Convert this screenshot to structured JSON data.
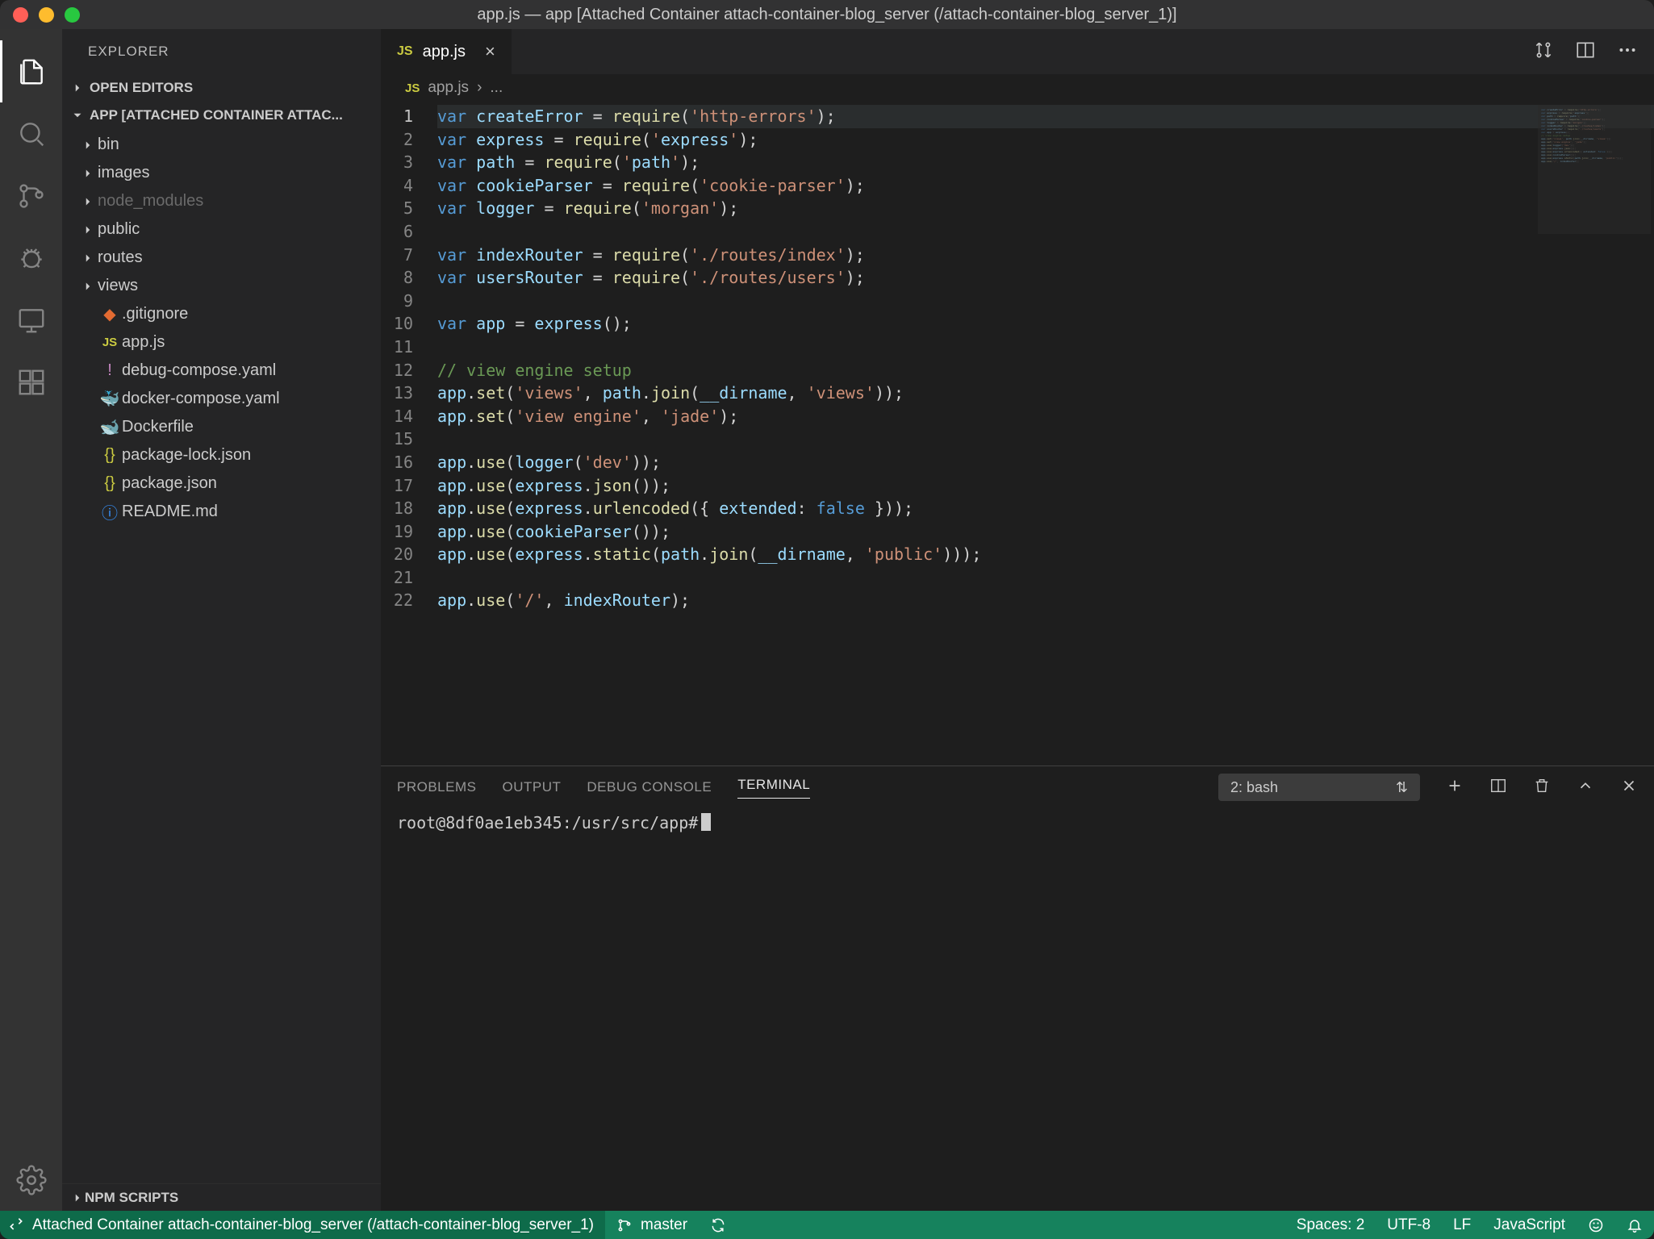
{
  "window": {
    "title": "app.js — app [Attached Container attach-container-blog_server (/attach-container-blog_server_1)]"
  },
  "sidebar": {
    "title": "EXPLORER",
    "open_editors": "OPEN EDITORS",
    "project_header": "APP [ATTACHED CONTAINER ATTAC...",
    "npm_scripts": "NPM SCRIPTS",
    "tree": {
      "bin": "bin",
      "images": "images",
      "node_modules": "node_modules",
      "public": "public",
      "routes": "routes",
      "views": "views",
      "gitignore": ".gitignore",
      "appjs": "app.js",
      "debug_compose": "debug-compose.yaml",
      "docker_compose": "docker-compose.yaml",
      "dockerfile": "Dockerfile",
      "package_lock": "package-lock.json",
      "package_json": "package.json",
      "readme": "README.md"
    }
  },
  "tabs": {
    "appjs": "app.js"
  },
  "breadcrumbs": {
    "file": "app.js",
    "more": "..."
  },
  "code_lines": [
    "var createError = require('http-errors');",
    "var express = require('express');",
    "var path = require('path');",
    "var cookieParser = require('cookie-parser');",
    "var logger = require('morgan');",
    "",
    "var indexRouter = require('./routes/index');",
    "var usersRouter = require('./routes/users');",
    "",
    "var app = express();",
    "",
    "// view engine setup",
    "app.set('views', path.join(__dirname, 'views'));",
    "app.set('view engine', 'jade');",
    "",
    "app.use(logger('dev'));",
    "app.use(express.json());",
    "app.use(express.urlencoded({ extended: false }));",
    "app.use(cookieParser());",
    "app.use(express.static(path.join(__dirname, 'public')));",
    "",
    "app.use('/', indexRouter);"
  ],
  "panel": {
    "problems": "PROBLEMS",
    "output": "OUTPUT",
    "debug_console": "DEBUG CONSOLE",
    "terminal": "TERMINAL",
    "term_select": "2: bash",
    "prompt": "root@8df0ae1eb345:/usr/src/app#"
  },
  "status": {
    "remote": "Attached Container attach-container-blog_server (/attach-container-blog_server_1)",
    "branch": "master",
    "spaces": "Spaces: 2",
    "encoding": "UTF-8",
    "eol": "LF",
    "lang": "JavaScript"
  }
}
